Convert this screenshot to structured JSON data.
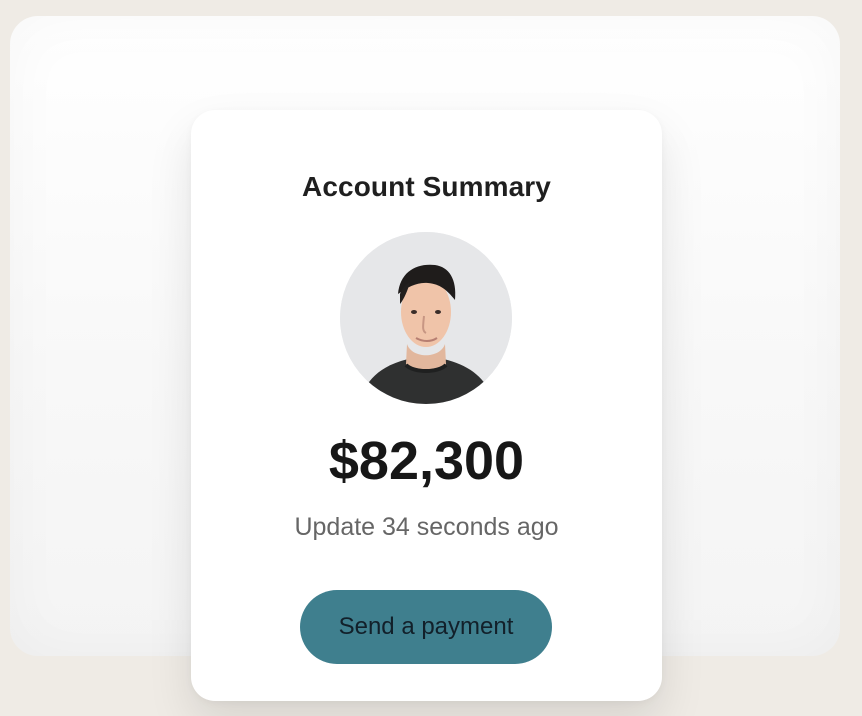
{
  "card": {
    "title": "Account Summary",
    "avatar_label": "User profile photo",
    "balance": "$82,300",
    "update_text": "Update 34 seconds ago",
    "button_label": "Send a payment"
  },
  "colors": {
    "background": "#efebe5",
    "panel": "#ffffff",
    "button": "#3f7f8e",
    "text_primary": "#171717",
    "text_secondary": "#666666"
  },
  "icons": {
    "avatar": "person-avatar"
  }
}
